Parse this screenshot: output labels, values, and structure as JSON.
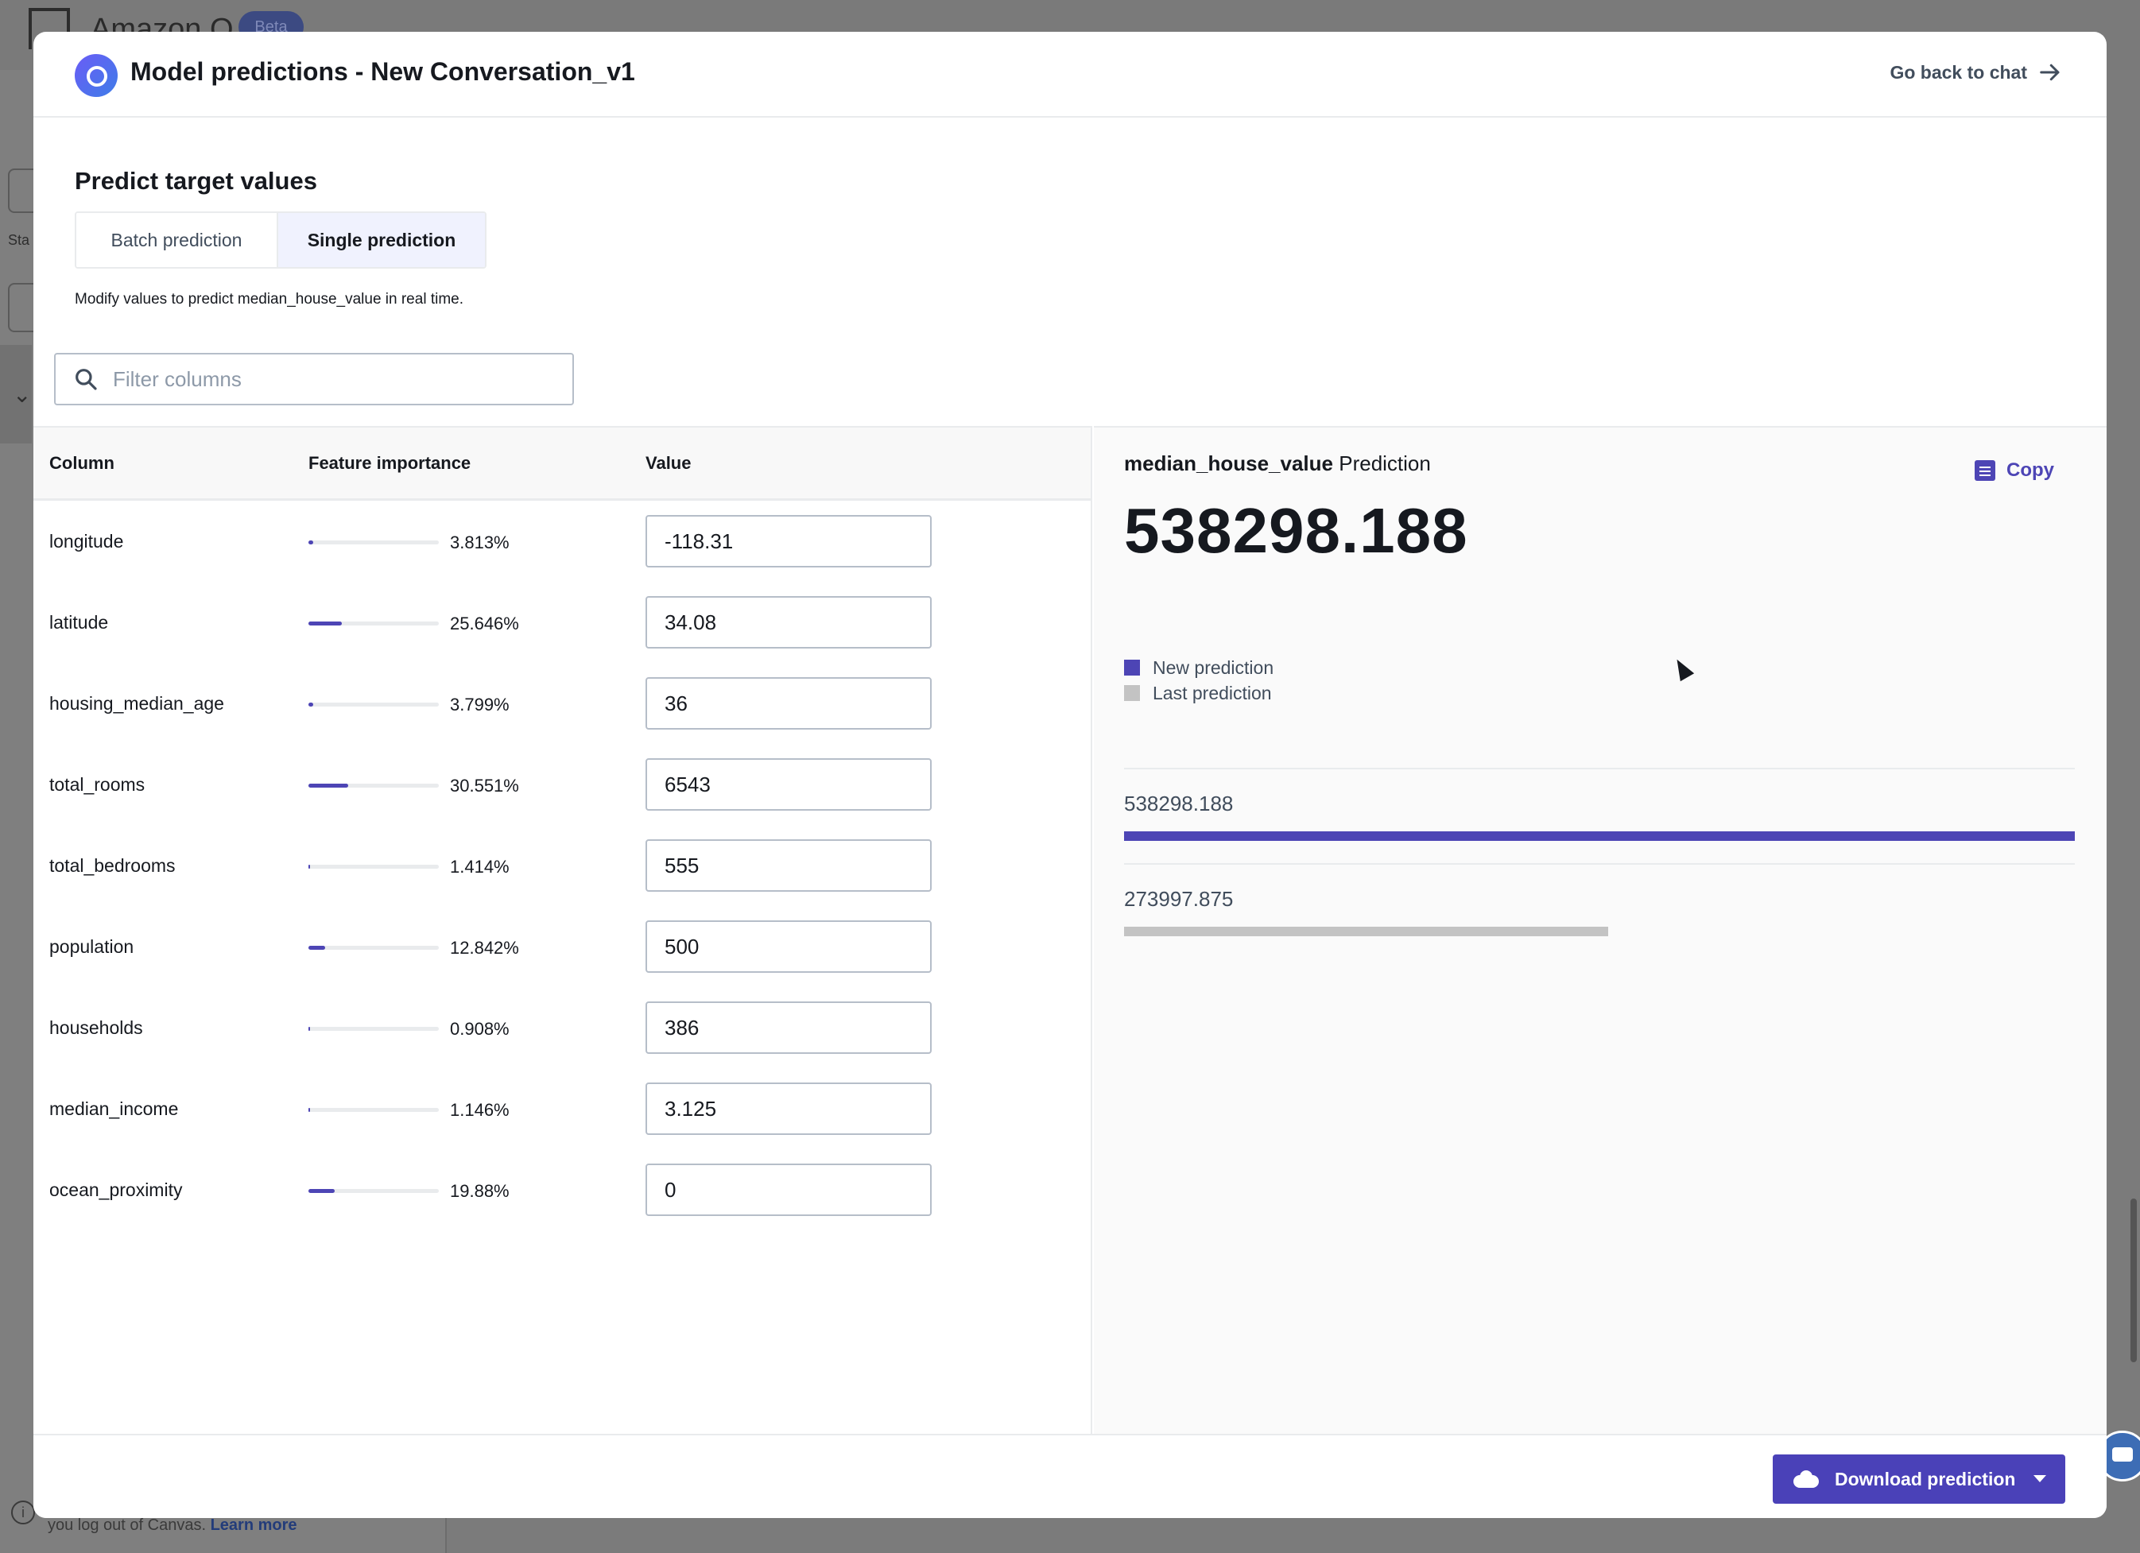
{
  "background": {
    "brand": "Amazon Q",
    "badge": "Beta",
    "sidebar_label_fragment": "Sta",
    "footer_text": "you log out of Canvas.",
    "footer_link": "Learn more"
  },
  "modal": {
    "title": "Model predictions - New Conversation_v1",
    "back_label": "Go back to chat",
    "section_title": "Predict target values",
    "tabs": [
      {
        "label": "Batch prediction",
        "selected": false
      },
      {
        "label": "Single prediction",
        "selected": true
      }
    ],
    "hint": "Modify values to predict median_house_value in real time.",
    "filter": {
      "placeholder": "Filter columns",
      "value": ""
    },
    "table": {
      "headers": {
        "column": "Column",
        "importance": "Feature importance",
        "value": "Value"
      },
      "rows": [
        {
          "column": "longitude",
          "importance": "3.813%",
          "importance_pct": 3.813,
          "value": "-118.31"
        },
        {
          "column": "latitude",
          "importance": "25.646%",
          "importance_pct": 25.646,
          "value": "34.08"
        },
        {
          "column": "housing_median_age",
          "importance": "3.799%",
          "importance_pct": 3.799,
          "value": "36"
        },
        {
          "column": "total_rooms",
          "importance": "30.551%",
          "importance_pct": 30.551,
          "value": "6543"
        },
        {
          "column": "total_bedrooms",
          "importance": "1.414%",
          "importance_pct": 1.414,
          "value": "555"
        },
        {
          "column": "population",
          "importance": "12.842%",
          "importance_pct": 12.842,
          "value": "500"
        },
        {
          "column": "households",
          "importance": "0.908%",
          "importance_pct": 0.908,
          "value": "386"
        },
        {
          "column": "median_income",
          "importance": "1.146%",
          "importance_pct": 1.146,
          "value": "3.125"
        },
        {
          "column": "ocean_proximity",
          "importance": "19.88%",
          "importance_pct": 19.88,
          "value": "0"
        }
      ]
    },
    "prediction": {
      "target": "median_house_value",
      "label_suffix": "Prediction",
      "copy_label": "Copy",
      "value": "538298.188",
      "legend": [
        {
          "label": "New prediction",
          "color": "#4d45b5"
        },
        {
          "label": "Last prediction",
          "color": "#c3c3c3"
        }
      ],
      "bars": [
        {
          "label": "538298.188",
          "value": 538298.188,
          "color": "#4d45b5"
        },
        {
          "label": "273997.875",
          "value": 273997.875,
          "color": "#c3c3c3"
        }
      ]
    },
    "download_label": "Download prediction"
  },
  "colors": {
    "accent": "#4d45b5",
    "button": "#4a41b8",
    "last": "#c3c3c3"
  }
}
